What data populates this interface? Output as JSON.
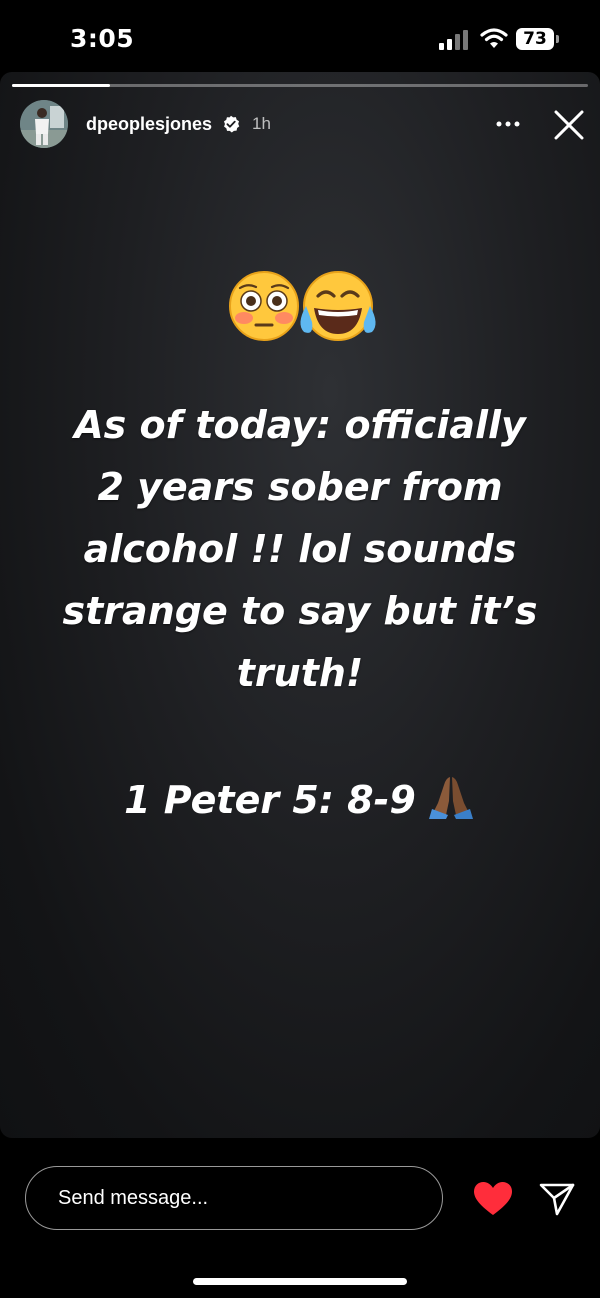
{
  "status_bar": {
    "time": "3:05",
    "battery": "73"
  },
  "story": {
    "progress": 0.17,
    "username": "dpeoplesjones",
    "verified": true,
    "time_ago": "1h",
    "emojis": [
      "flushed-face",
      "face-with-tears-of-joy"
    ],
    "text": "As of today: officially\n2 years sober from\nalcohol !! lol sounds\nstrange to say but it’s\ntruth!",
    "verse": "1 Peter 5: 8-9",
    "verse_emoji": "folded-hands"
  },
  "reply_bar": {
    "placeholder": "Send message..."
  },
  "colors": {
    "heart": "#ff2d3b",
    "background": "#000000"
  }
}
